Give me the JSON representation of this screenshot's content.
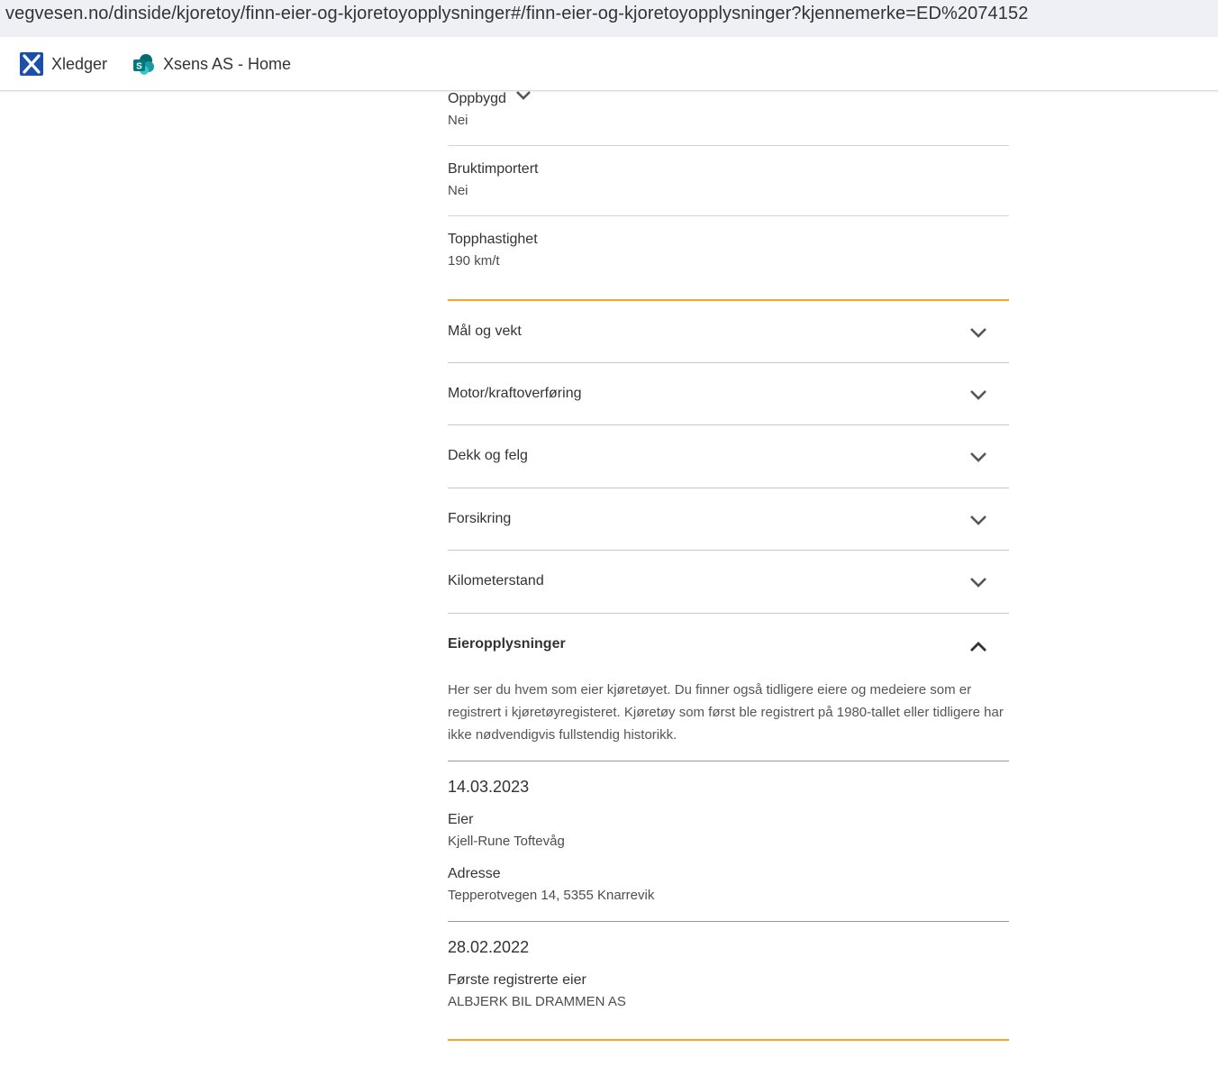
{
  "browser": {
    "url": "vegvesen.no/dinside/kjoretoy/finn-eier-og-kjoretoyopplysninger#/finn-eier-og-kjoretoyopplysninger?kjennemerke=ED%2074152",
    "bookmarks": [
      {
        "label": "Xledger",
        "icon": "xledger-icon"
      },
      {
        "label": "Xsens AS - Home",
        "icon": "sharepoint-icon"
      }
    ]
  },
  "fields": [
    {
      "label": "Oppbygd",
      "value": "Nei"
    },
    {
      "label": "Bruktimportert",
      "value": "Nei"
    },
    {
      "label": "Topphastighet",
      "value": "190 km/t"
    }
  ],
  "accordions": [
    {
      "title": "Mål og vekt"
    },
    {
      "title": "Motor/kraftoverføring"
    },
    {
      "title": "Dekk og felg"
    },
    {
      "title": "Forsikring"
    },
    {
      "title": "Kilometerstand"
    }
  ],
  "owners": {
    "title": "Eieropplysninger",
    "intro": "Her ser du hvem som eier kjøretøyet. Du finner også tidligere eiere og medeiere som er registrert i kjøretøyregisteret. Kjøretøy som først ble registrert på 1980-tallet eller tidligere har ikke nødvendigvis fullstendig historikk.",
    "entries": [
      {
        "date": "14.03.2023",
        "items": [
          {
            "label": "Eier",
            "value": "Kjell-Rune Toftevåg"
          },
          {
            "label": "Adresse",
            "value": "Tepperotvegen 14, 5355 Knarrevik"
          }
        ]
      },
      {
        "date": "28.02.2022",
        "items": [
          {
            "label": "Første registrerte eier",
            "value": "ALBJERK BIL DRAMMEN AS"
          }
        ]
      }
    ]
  },
  "colors": {
    "accent_orange": "#f5a623",
    "url_bar_bg": "#eef0f6"
  }
}
